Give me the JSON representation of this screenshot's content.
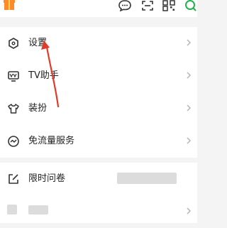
{
  "colors": {
    "background": "#f4f4f4",
    "card": "#ffffff",
    "text": "#222222",
    "icon": "#333333",
    "chevron": "#b5b5b5",
    "accent_green": "#22b24c",
    "gift_orange": "#ff8a2a",
    "annotation_red": "#e23a2a"
  },
  "header": {
    "icons": [
      "gift-icon",
      "message-icon",
      "scan-icon",
      "qr-code-icon",
      "search-icon"
    ]
  },
  "menu": {
    "items": [
      {
        "label": "设置",
        "icon": "settings-hex-icon"
      },
      {
        "label": "TV助手",
        "icon": "tv-icon"
      },
      {
        "label": "装扮",
        "icon": "tshirt-icon"
      },
      {
        "label": "免流量服务",
        "icon": "data-flow-icon"
      }
    ]
  },
  "secondary": {
    "survey_label": "限时问卷",
    "survey_icon": "edit-icon"
  }
}
